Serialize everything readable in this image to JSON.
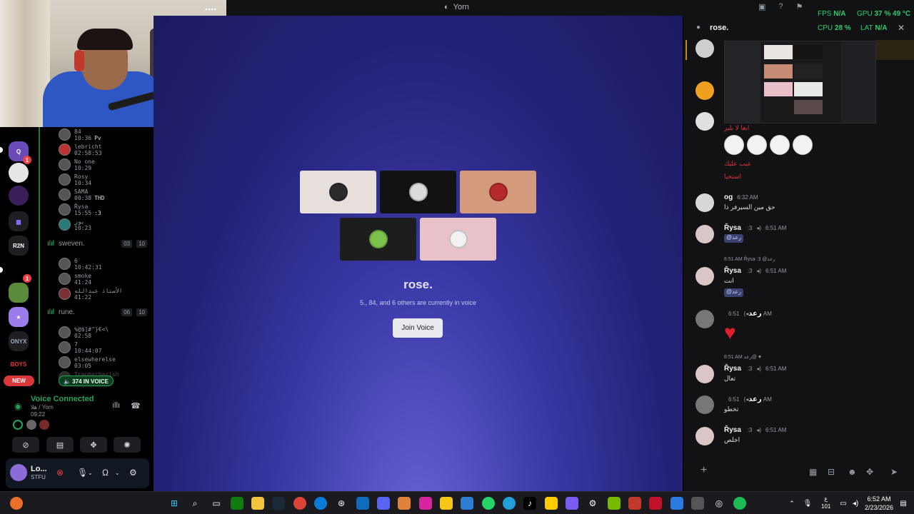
{
  "window": {
    "title": "Yorn"
  },
  "overlay": {
    "fps_label": "FPS",
    "fps_value": "N/A",
    "gpu_label": "GPU",
    "gpu_value": "37 % 49 °C",
    "cpu_label": "CPU",
    "cpu_value": "28 %",
    "lat_label": "LAT",
    "lat_value": "N/A"
  },
  "servers": {
    "new_label": "NEW",
    "items": [
      {
        "name": "Q",
        "badge": "1"
      },
      {
        "name": "",
        "badge": ""
      },
      {
        "name": "",
        "badge": ""
      },
      {
        "name": "",
        "badge": ""
      },
      {
        "name": "R2N",
        "badge": ""
      },
      {
        "name": "",
        "badge": "1"
      },
      {
        "name": "",
        "badge": ""
      },
      {
        "name": "",
        "badge": ""
      },
      {
        "name": "ONYX",
        "badge": ""
      },
      {
        "name": "BOYS",
        "badge": ""
      }
    ]
  },
  "voice_users_top": [
    {
      "name": "84",
      "time": "10:36",
      "tag": "Pv"
    },
    {
      "name": "lebricht",
      "time": "02:58:53",
      "tag": ""
    },
    {
      "name": "No one",
      "time": "10:29",
      "tag": ""
    },
    {
      "name": "Rosy",
      "time": "10:34",
      "tag": ""
    },
    {
      "name": "SAMA",
      "time": "00:38",
      "tag": "THD"
    },
    {
      "name": "Řysa",
      "time": "15:55",
      "tag": ":3"
    },
    {
      "name": "يوز",
      "time": "10:23",
      "tag": ""
    }
  ],
  "channel_sweven": {
    "name": "sweven.",
    "count_a": "03",
    "count_b": "10"
  },
  "voice_users_mid": [
    {
      "name": "6",
      "time": "10:42:31"
    },
    {
      "name": "smoke",
      "time": "41:24"
    },
    {
      "name": "الأستاذ عبدالله",
      "time": "41:22"
    }
  ],
  "channel_rune": {
    "name": "rune.",
    "count_a": "06",
    "count_b": "10"
  },
  "voice_users_low": [
    {
      "name": "%@$]#\"}€<\\",
      "time": "02:58"
    },
    {
      "name": "7",
      "time": "10:44:07"
    },
    {
      "name": "elsewherelse",
      "time": "03:05"
    },
    {
      "name": "Trapberbarish",
      "time": ""
    }
  ],
  "in_voice_label": "374 IN VOICE",
  "voice_panel": {
    "status": "Voice Connected",
    "channel": "هلا / Yorn",
    "timer": "09:22"
  },
  "user": {
    "name": "Lo...",
    "status": "STFU"
  },
  "stage": {
    "title": "rose.",
    "subtitle": "5., 84, and 6 others are currently in voice",
    "join_label": "Join Voice",
    "tiles": [
      {
        "bg": "#e7dfdc",
        "avatar": "#2b2b2b"
      },
      {
        "bg": "#121212",
        "avatar": "#dcdcdc"
      },
      {
        "bg": "#d39a7e",
        "avatar": "#b52b2b"
      },
      {
        "bg": "#1d1d1d",
        "avatar": "#7ac24a"
      },
      {
        "bg": "#e9c1c8",
        "avatar": "#f2f2f2"
      }
    ]
  },
  "chat": {
    "title": "rose.",
    "red_caption": "ابغا لا بليز",
    "red_line1": "عيب عليك",
    "red_line2": "استحيا",
    "messages": [
      {
        "author": "og",
        "time": "6:32 AM",
        "text": "حق مين السيرفر ذا"
      },
      {
        "author": "Řysa",
        "badge": ":3",
        "time": "6:51 AM",
        "mention": "@رعد"
      },
      {
        "reply": "6:51 AM  Řysa :3 @رعد",
        "author": "Řysa",
        "badge": ":3",
        "time": "6:51 AM",
        "text": "انت",
        "mention": "@رعد"
      },
      {
        "author": "رعد",
        "time": "6:51 AM",
        "heart": "♥"
      },
      {
        "reply": "6:51 AM  رعد@ ♥",
        "author": "Řysa",
        "badge": ":3",
        "time": "6:51 AM",
        "text": "تعال"
      },
      {
        "author": "رعد",
        "time": "6:51 AM",
        "text": "تخطو"
      },
      {
        "author": "Řysa",
        "badge": ":3",
        "time": "6:51 AM",
        "text": "اخلص"
      }
    ]
  },
  "taskbar": {
    "clock_time": "6:52 AM",
    "clock_date": "2/23/2026",
    "lang": "ع",
    "lang_sub": "101"
  }
}
